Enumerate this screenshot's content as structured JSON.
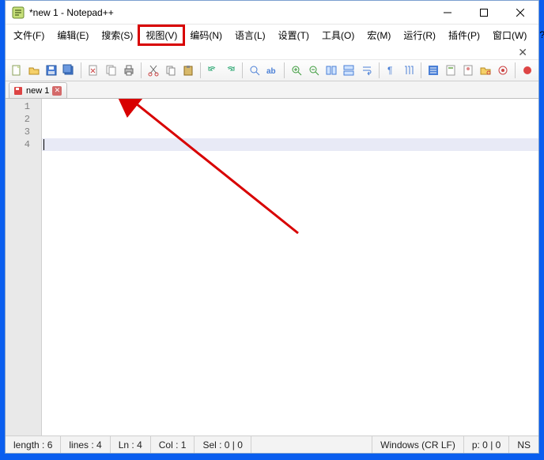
{
  "title": "*new 1 - Notepad++",
  "menus": {
    "file": "文件(F)",
    "edit": "编辑(E)",
    "search": "搜索(S)",
    "view": "视图(V)",
    "encoding": "编码(N)",
    "language": "语言(L)",
    "settings": "设置(T)",
    "tools": "工具(O)",
    "macro": "宏(M)",
    "run": "运行(R)",
    "plugins": "插件(P)",
    "window": "窗口(W)",
    "help": "?"
  },
  "tab": {
    "label": "new 1"
  },
  "lines": [
    "1",
    "2",
    "3",
    "4"
  ],
  "current_line_index": 3,
  "status": {
    "length": "length : 6",
    "lines": "lines : 4",
    "ln": "Ln : 4",
    "col": "Col : 1",
    "sel": "Sel : 0 | 0",
    "eol": "Windows (CR LF)",
    "extra": "p: 0 | 0",
    "ins": "NS"
  }
}
